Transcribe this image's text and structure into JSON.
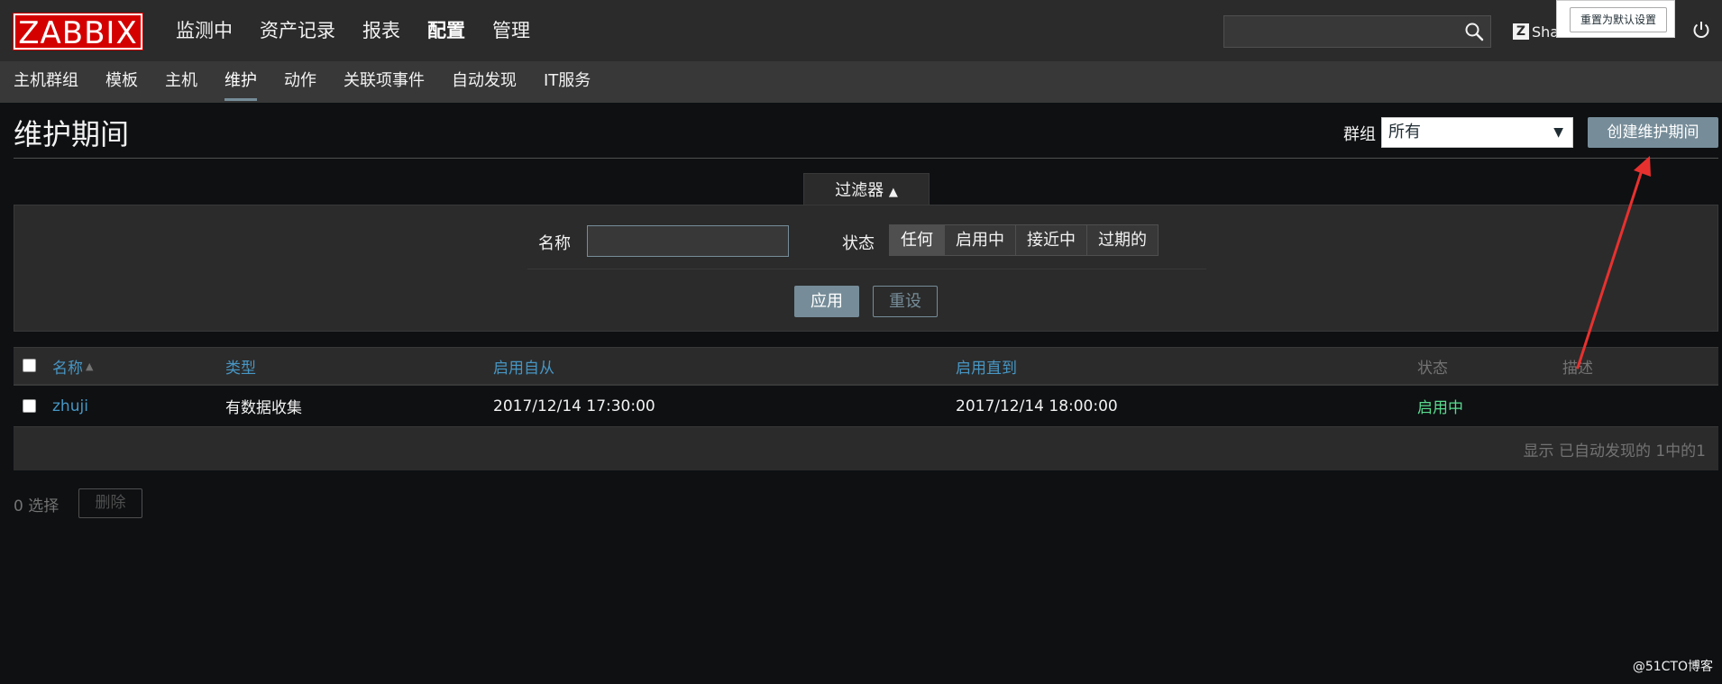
{
  "app": {
    "logo": "ZABBIX",
    "main_menu": [
      {
        "label": "监测中",
        "active": false
      },
      {
        "label": "资产记录",
        "active": false
      },
      {
        "label": "报表",
        "active": false
      },
      {
        "label": "配置",
        "active": true
      },
      {
        "label": "管理",
        "active": false
      }
    ],
    "search_value": "",
    "share_label": "Shar",
    "tooltip_button": "重置为默认设置"
  },
  "submenu": [
    {
      "label": "主机群组",
      "active": false
    },
    {
      "label": "模板",
      "active": false
    },
    {
      "label": "主机",
      "active": false
    },
    {
      "label": "维护",
      "active": true
    },
    {
      "label": "动作",
      "active": false
    },
    {
      "label": "关联项事件",
      "active": false
    },
    {
      "label": "自动发现",
      "active": false
    },
    {
      "label": "IT服务",
      "active": false
    }
  ],
  "header": {
    "title": "维护期间",
    "group_label": "群组",
    "group_value": "所有",
    "create_button": "创建维护期间"
  },
  "filter": {
    "tab_label": "过滤器",
    "name_label": "名称",
    "name_value": "",
    "state_label": "状态",
    "state_options": [
      {
        "label": "任何",
        "selected": true
      },
      {
        "label": "启用中",
        "selected": false
      },
      {
        "label": "接近中",
        "selected": false
      },
      {
        "label": "过期的",
        "selected": false
      }
    ],
    "apply_label": "应用",
    "reset_label": "重设"
  },
  "table": {
    "headers": {
      "name": "名称",
      "type": "类型",
      "active_since": "启用自从",
      "active_till": "启用直到",
      "state": "状态",
      "description": "描述"
    },
    "rows": [
      {
        "name": "zhuji",
        "type": "有数据收集",
        "active_since": "2017/12/14 17:30:00",
        "active_till": "2017/12/14 18:00:00",
        "state": "启用中",
        "description": ""
      }
    ],
    "footer": "显示 已自动发现的 1中的1"
  },
  "bulk": {
    "selected": "0 选择",
    "delete_label": "删除"
  },
  "watermark": "@51CTO博客",
  "colors": {
    "brand_red": "#d40000",
    "link_blue": "#4796c4",
    "status_green": "#59db8f",
    "button_slate": "#768d99",
    "annotation_red": "#e8312f"
  }
}
